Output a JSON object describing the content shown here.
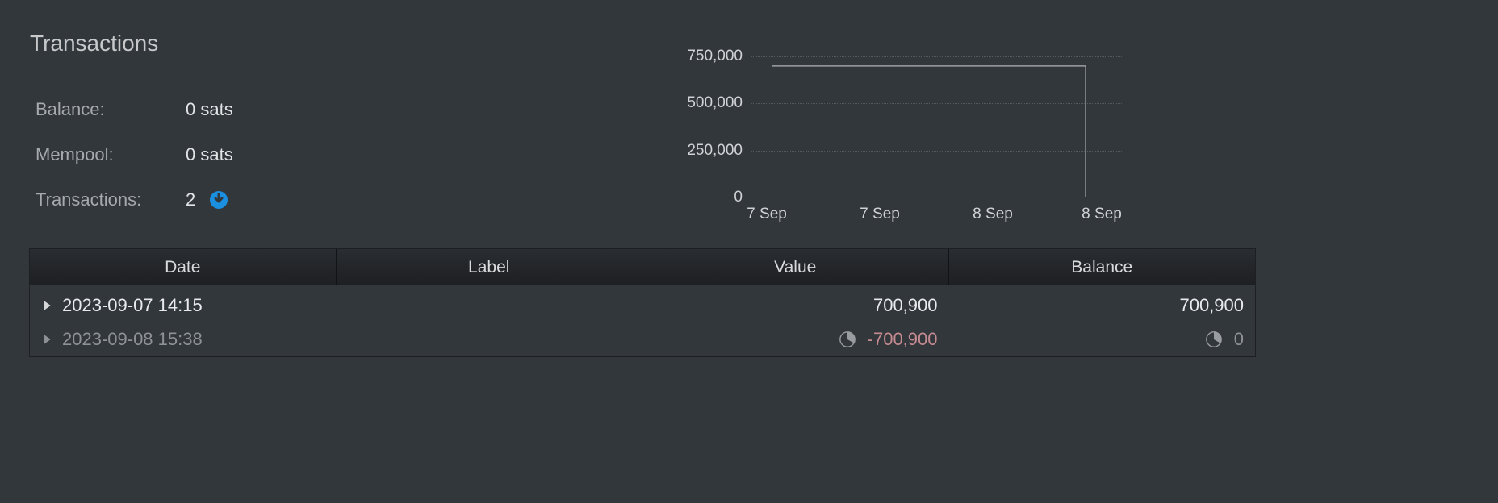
{
  "header": {
    "title": "Transactions"
  },
  "stats": {
    "balance_label": "Balance:",
    "balance_value": "0 sats",
    "mempool_label": "Mempool:",
    "mempool_value": "0 sats",
    "transactions_label": "Transactions:",
    "transactions_value": "2"
  },
  "chart_data": {
    "type": "line",
    "title": "",
    "xlabel": "",
    "ylabel": "",
    "ylim": [
      0,
      750000
    ],
    "y_ticks": [
      "0",
      "250,000",
      "500,000",
      "750,000"
    ],
    "x_ticks": [
      "7 Sep",
      "7 Sep",
      "8 Sep",
      "8 Sep"
    ],
    "series": [
      {
        "name": "balance",
        "step": true,
        "points": [
          {
            "x": "2023-09-07 14:15",
            "y": 700900
          },
          {
            "x": "2023-09-08 15:38",
            "y": 0
          }
        ]
      }
    ]
  },
  "table": {
    "columns": {
      "date": "Date",
      "label": "Label",
      "value": "Value",
      "balance": "Balance"
    },
    "rows": [
      {
        "date": "2023-09-07 14:15",
        "label": "",
        "value": "700,900",
        "balance": "700,900",
        "pending": false,
        "negative": false
      },
      {
        "date": "2023-09-08 15:38",
        "label": "",
        "value": "-700,900",
        "balance": "0",
        "pending": true,
        "negative": true
      }
    ]
  },
  "colors": {
    "accent": "#1b8fe0",
    "negative": "#c58b91",
    "chart_line": "#9da0a3"
  }
}
